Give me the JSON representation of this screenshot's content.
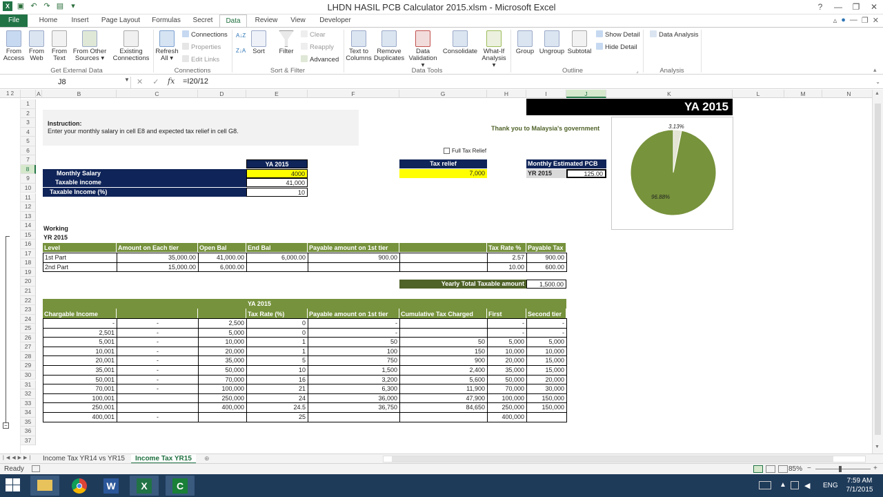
{
  "window": {
    "title": "LHDN HASIL PCB Calculator 2015.xlsm - Microsoft Excel"
  },
  "tabs": [
    "File",
    "Home",
    "Insert",
    "Page Layout",
    "Formulas",
    "Secret",
    "Data",
    "Review",
    "View",
    "Developer"
  ],
  "ribbon": {
    "from_access": [
      "From",
      "Access"
    ],
    "from_web": [
      "From",
      "Web"
    ],
    "from_text": [
      "From",
      "Text"
    ],
    "from_other": [
      "From Other",
      "Sources ▾"
    ],
    "existing": [
      "Existing",
      "Connections"
    ],
    "refresh": [
      "Refresh",
      "All ▾"
    ],
    "connections": "Connections",
    "properties": "Properties",
    "edit_links": "Edit Links",
    "sort": "Sort",
    "filter": "Filter",
    "clear": "Clear",
    "reapply": "Reapply",
    "advanced": "Advanced",
    "text_to_columns": [
      "Text to",
      "Columns"
    ],
    "remove_duplicates": [
      "Remove",
      "Duplicates"
    ],
    "data_validation": [
      "Data",
      "Validation ▾"
    ],
    "consolidate": "Consolidate",
    "what_if": [
      "What-If",
      "Analysis ▾"
    ],
    "group": "Group",
    "ungroup": "Ungroup",
    "subtotal": "Subtotal",
    "show_detail": "Show Detail",
    "hide_detail": "Hide Detail",
    "data_analysis": "Data Analysis",
    "groups": {
      "get_external": "Get External Data",
      "connections": "Connections",
      "sort_filter": "Sort & Filter",
      "data_tools": "Data Tools",
      "outline": "Outline",
      "analysis": "Analysis"
    }
  },
  "formula_bar": {
    "name_box": "J8",
    "fx": "fx",
    "formula": "=I20/12"
  },
  "columns": [
    "A",
    "B",
    "C",
    "D",
    "E",
    "F",
    "G",
    "H",
    "I",
    "J",
    "K",
    "L",
    "M",
    "N"
  ],
  "rows": [
    "1",
    "2",
    "3",
    "4",
    "5",
    "6",
    "7",
    "8",
    "9",
    "10",
    "11",
    "12",
    "13",
    "14",
    "15",
    "16",
    "17",
    "18",
    "19",
    "20",
    "21",
    "22",
    "23",
    "24",
    "25",
    "26",
    "27",
    "28",
    "29",
    "30",
    "31",
    "32",
    "33",
    "34",
    "35",
    "36",
    "37"
  ],
  "sheet": {
    "instruction_title": "Instruction:",
    "instruction_text": "Enter your monthly salary in cell E8 and expected tax relief in cell G8.",
    "ya_banner": "YA 2015",
    "thanks": "Thank you to Malaysia's government",
    "full_tax_relief": "Full Tax Relief",
    "monthly_salary_label": "Monthly Salary",
    "taxable_income_label": "Taxable income",
    "taxable_income_pct_label": "Taxable Income (%)",
    "ya2015_header": "YA 2015",
    "monthly_salary": "4000",
    "taxable_income": "41,000",
    "taxable_income_pct": "10",
    "tax_relief_label": "Tax relief",
    "tax_relief": "7,000",
    "pcb_label": "Monthly Estimated PCB",
    "pcb_year": "YR 2015",
    "pcb_value": "125.00",
    "working": "Working",
    "yr2015": "YR 2015",
    "t1_headers": [
      "Level",
      "Amount on Each tier",
      "Open Bal",
      "End Bal",
      "Payable amount on 1st tier",
      "",
      "Tax Rate %",
      "Payable Tax"
    ],
    "t1_rows": [
      [
        "1st Part",
        "35,000.00",
        "41,000.00",
        "6,000.00",
        "900.00",
        "",
        "2.57",
        "900.00"
      ],
      [
        "2nd Part",
        "15,000.00",
        "6,000.00",
        "",
        "",
        "",
        "10.00",
        "600.00"
      ]
    ],
    "yearly_total_label": "Yearly Total Taxable amount",
    "yearly_total": "1,500.00",
    "t2_ya": "YA 2015",
    "t2_headers": [
      "Chargable Income",
      "",
      "",
      "Tax Rate (%)",
      "Payable amount on 1st tier",
      "Cumulative Tax Charged",
      "First",
      "Second tier"
    ],
    "t2_rows": [
      [
        "-",
        "-",
        "2,500",
        "0",
        "-",
        "",
        "-",
        "-"
      ],
      [
        "2,501",
        "-",
        "5,000",
        "0",
        "-",
        "",
        "-",
        "-"
      ],
      [
        "5,001",
        "-",
        "10,000",
        "1",
        "50",
        "50",
        "5,000",
        "5,000"
      ],
      [
        "10,001",
        "-",
        "20,000",
        "1",
        "100",
        "150",
        "10,000",
        "10,000"
      ],
      [
        "20,001",
        "-",
        "35,000",
        "5",
        "750",
        "900",
        "20,000",
        "15,000"
      ],
      [
        "35,001",
        "-",
        "50,000",
        "10",
        "1,500",
        "2,400",
        "35,000",
        "15,000"
      ],
      [
        "50,001",
        "-",
        "70,000",
        "16",
        "3,200",
        "5,600",
        "50,000",
        "20,000"
      ],
      [
        "70,001",
        "-",
        "100,000",
        "21",
        "6,300",
        "11,900",
        "70,000",
        "30,000"
      ],
      [
        "100,001",
        "",
        "250,000",
        "24",
        "36,000",
        "47,900",
        "100,000",
        "150,000"
      ],
      [
        "250,001",
        "",
        "400,000",
        "24.5",
        "36,750",
        "84,650",
        "250,000",
        "150,000"
      ],
      [
        "400,001",
        "-",
        "",
        "25",
        "",
        "",
        "400,000",
        ""
      ]
    ]
  },
  "chart_data": {
    "type": "pie",
    "values": [
      3.13,
      96.88
    ],
    "labels": [
      "3.13%",
      "96.88%"
    ],
    "colors": [
      "#e4e4d4",
      "#77933c"
    ]
  },
  "sheet_tabs": [
    "Income Tax YR14 vs YR15",
    "Income Tax YR15"
  ],
  "status": {
    "ready": "Ready",
    "zoom": "85%"
  },
  "taskbar": {
    "lang": "ENG",
    "time": "7:59 AM",
    "date": "7/1/2015"
  }
}
